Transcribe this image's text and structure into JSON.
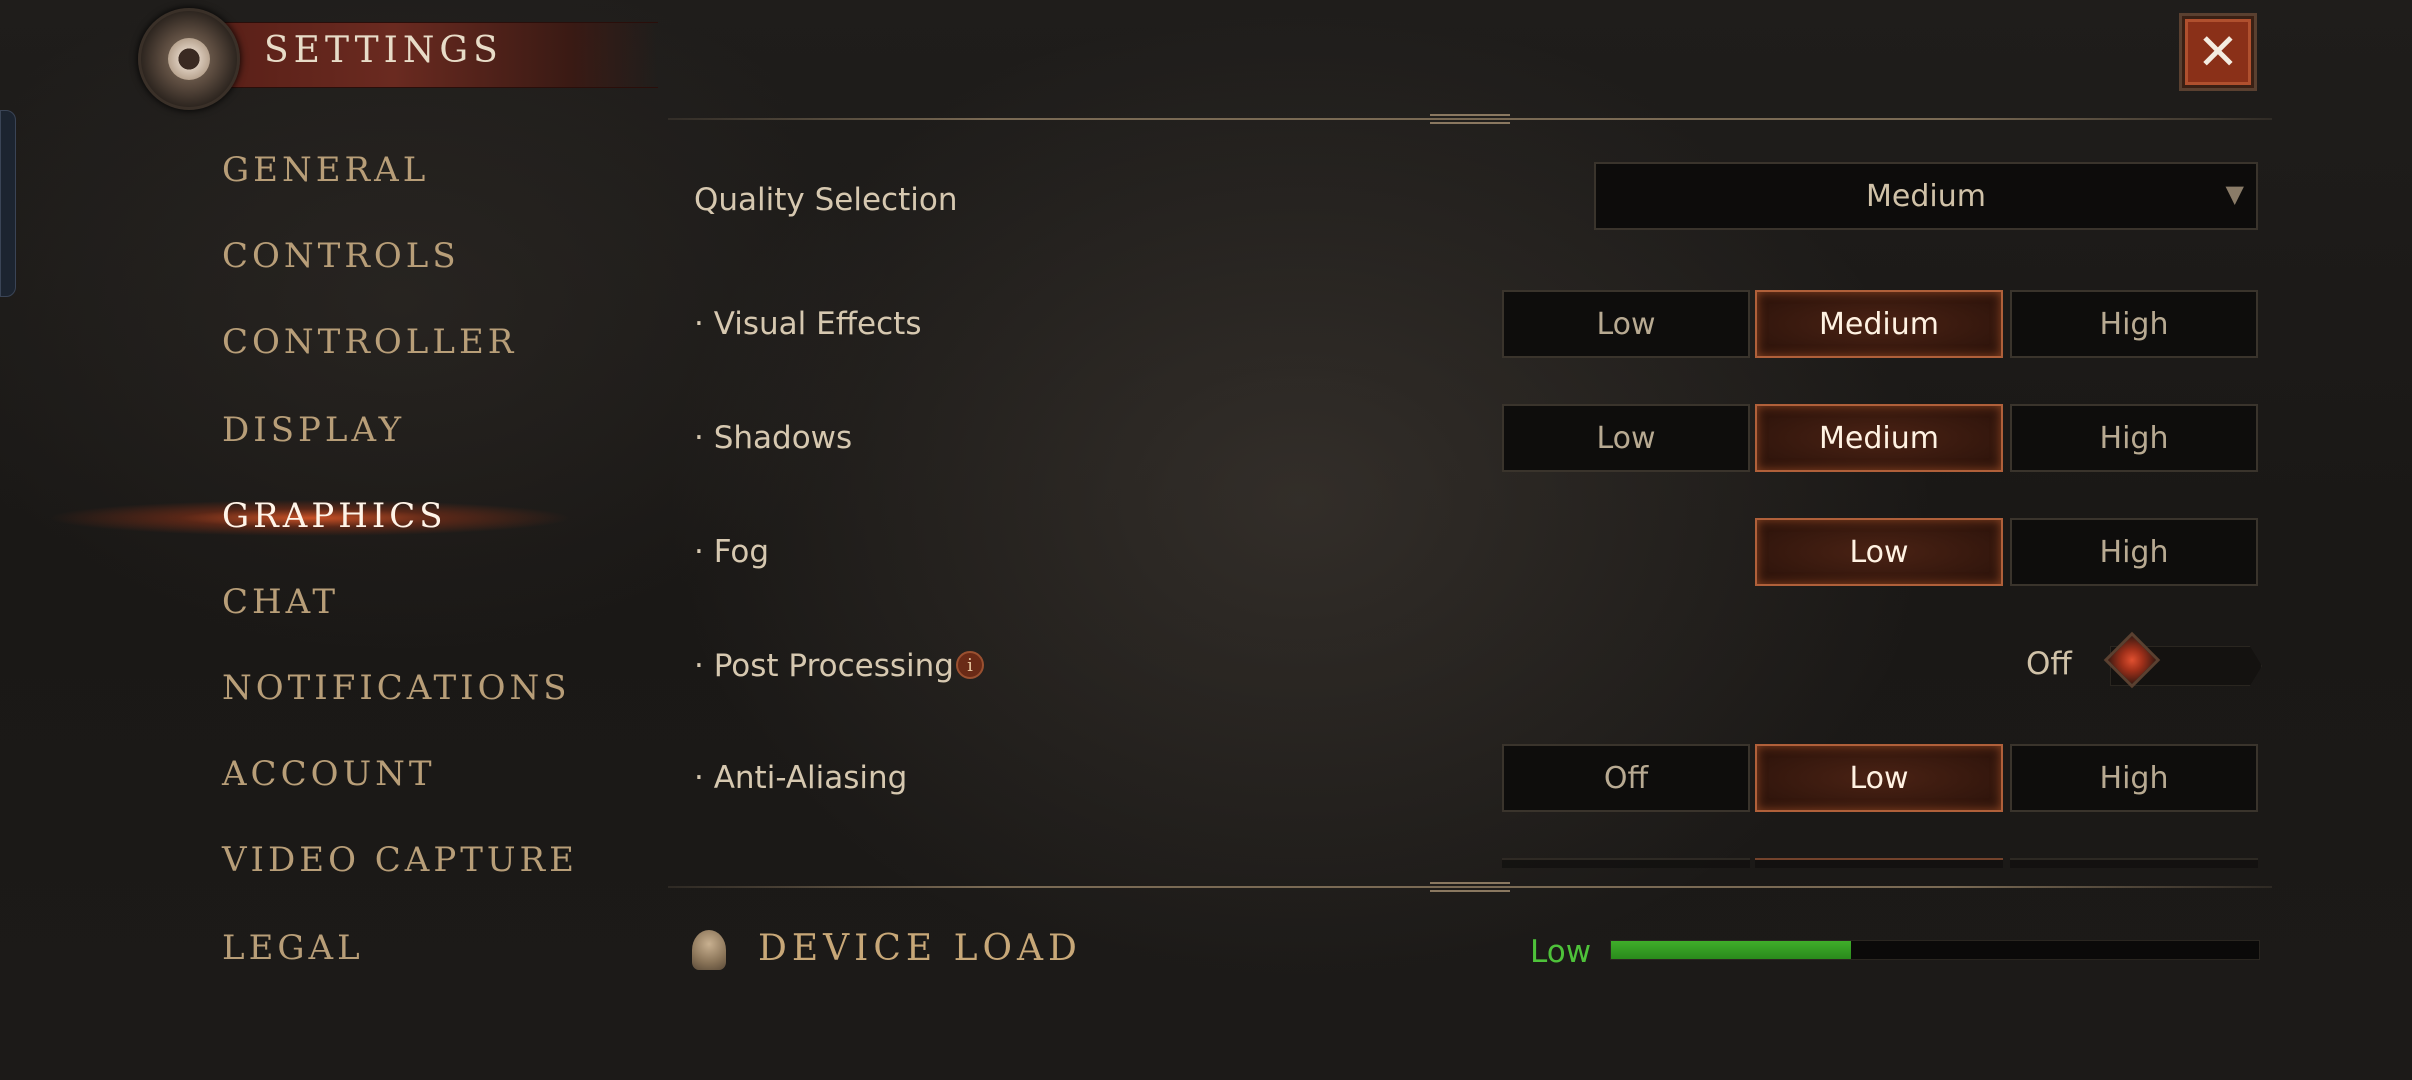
{
  "header": {
    "title": "SETTINGS",
    "close_icon": "close-x-icon"
  },
  "sidebar": {
    "items": [
      {
        "label": "GENERAL",
        "active": false
      },
      {
        "label": "CONTROLS",
        "active": false
      },
      {
        "label": "CONTROLLER",
        "active": false
      },
      {
        "label": "DISPLAY",
        "active": false
      },
      {
        "label": "GRAPHICS",
        "active": true
      },
      {
        "label": "CHAT",
        "active": false
      },
      {
        "label": "NOTIFICATIONS",
        "active": false
      },
      {
        "label": "ACCOUNT",
        "active": false
      },
      {
        "label": "VIDEO CAPTURE",
        "active": false
      },
      {
        "label": "LEGAL",
        "active": false
      }
    ]
  },
  "graphics": {
    "quality": {
      "label": "Quality Selection",
      "value": "Medium"
    },
    "visual_effects": {
      "label": "· Visual Effects",
      "options": [
        "Low",
        "Medium",
        "High"
      ],
      "selected": "Medium"
    },
    "shadows": {
      "label": "· Shadows",
      "options": [
        "Low",
        "Medium",
        "High"
      ],
      "selected": "Medium"
    },
    "fog": {
      "label": "· Fog",
      "options": [
        "Low",
        "High"
      ],
      "selected": "Low"
    },
    "post_processing": {
      "label": "· Post Processing",
      "toggle_label": "Off",
      "enabled": false,
      "info_icon": "info-icon"
    },
    "anti_aliasing": {
      "label": "· Anti-Aliasing",
      "options": [
        "Off",
        "Low",
        "High"
      ],
      "selected": "Low"
    }
  },
  "footer": {
    "title": "DEVICE LOAD",
    "load_label": "Low",
    "load_fraction": 0.37,
    "load_color": "#3fae2a"
  },
  "colors": {
    "accent": "#b0603a",
    "close_button": "#8a3018"
  }
}
